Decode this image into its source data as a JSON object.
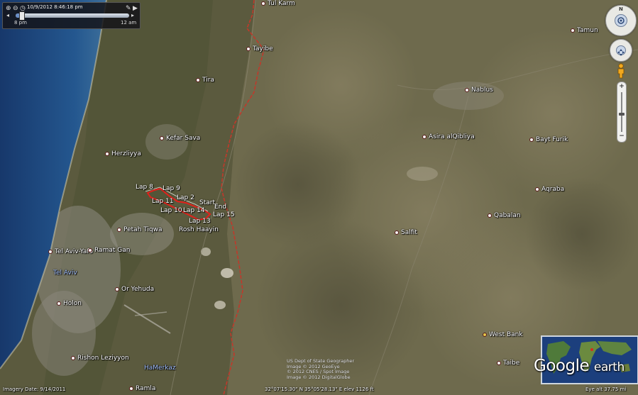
{
  "time_slider": {
    "date_time": "10/9/2012   8:46:18 pm",
    "start_label": "8 pm",
    "end_label": "12 am",
    "position": 0.05
  },
  "places": {
    "tul_karm": "Tul Karm",
    "tamun": "Tamun",
    "tayibe": "Tayibe",
    "tira": "Tira",
    "nablus": "Nablus",
    "kefar_sava": "Kefar Sava",
    "asira": "Asira alQibliya",
    "bayt_furik": "Bayt Furik",
    "herzliyya": "Herzliyya",
    "aqraba": "Aqraba",
    "qabalan": "Qabalan",
    "salfit": "Salfit",
    "petah_tiqwa": "Petah Tiqwa",
    "rosh_haayin": "Rosh Haayin",
    "tel_aviv_yafo": "Tel Aviv-Yafo",
    "ramat_gan": "Ramat Gan",
    "tel_aviv": "Tel Aviv",
    "or_yehuda": "Or Yehuda",
    "holon": "Holon",
    "west_bank": "West Bank",
    "taibe": "Taibe",
    "rishon": "Rishon Leziyyon",
    "hamerkaz": "HaMerkaz",
    "ramla": "Ramla"
  },
  "laps": {
    "lap8": "Lap 8",
    "lap9": "Lap 9",
    "lap11": "Lap 11",
    "lap2": "Lap 2",
    "start": "Start",
    "lap10": "Lap 10",
    "lap14": "Lap 14",
    "end": "End",
    "lap15": "Lap 15",
    "lap13": "Lap 13"
  },
  "navigation": {
    "look_north": "N",
    "zoom_in": "+",
    "zoom_out": "−",
    "zoom_level": 0.45
  },
  "credits": {
    "line1": "US Dept of State Geographer",
    "line2": "Image © 2012 GeoEye",
    "line3": "© 2012 CNES / Spot Image",
    "line4": "Image © 2012 DigitalGlobe"
  },
  "logo": {
    "google": "Google",
    "earth": "earth"
  },
  "status": {
    "imagery_date": "Imagery Date: 9/14/2011",
    "coordinates": "32°07'15.30\" N  35°05'28.13\" E  elev  1126 ft",
    "eye_alt": "Eye alt   37.75 mi"
  },
  "icons": {
    "time_slider": [
      "zoom-in-icon",
      "zoom-out-icon",
      "clock-icon",
      "settings-wrench-icon",
      "play-icon"
    ],
    "nav": [
      "look-joystick-icon",
      "move-joystick-icon",
      "pegman-icon"
    ]
  },
  "colors": {
    "border_line": "#c0392b",
    "track_red": "#e3201b",
    "sea": "#1d4e8c",
    "terrain": "#6e6a4d"
  }
}
